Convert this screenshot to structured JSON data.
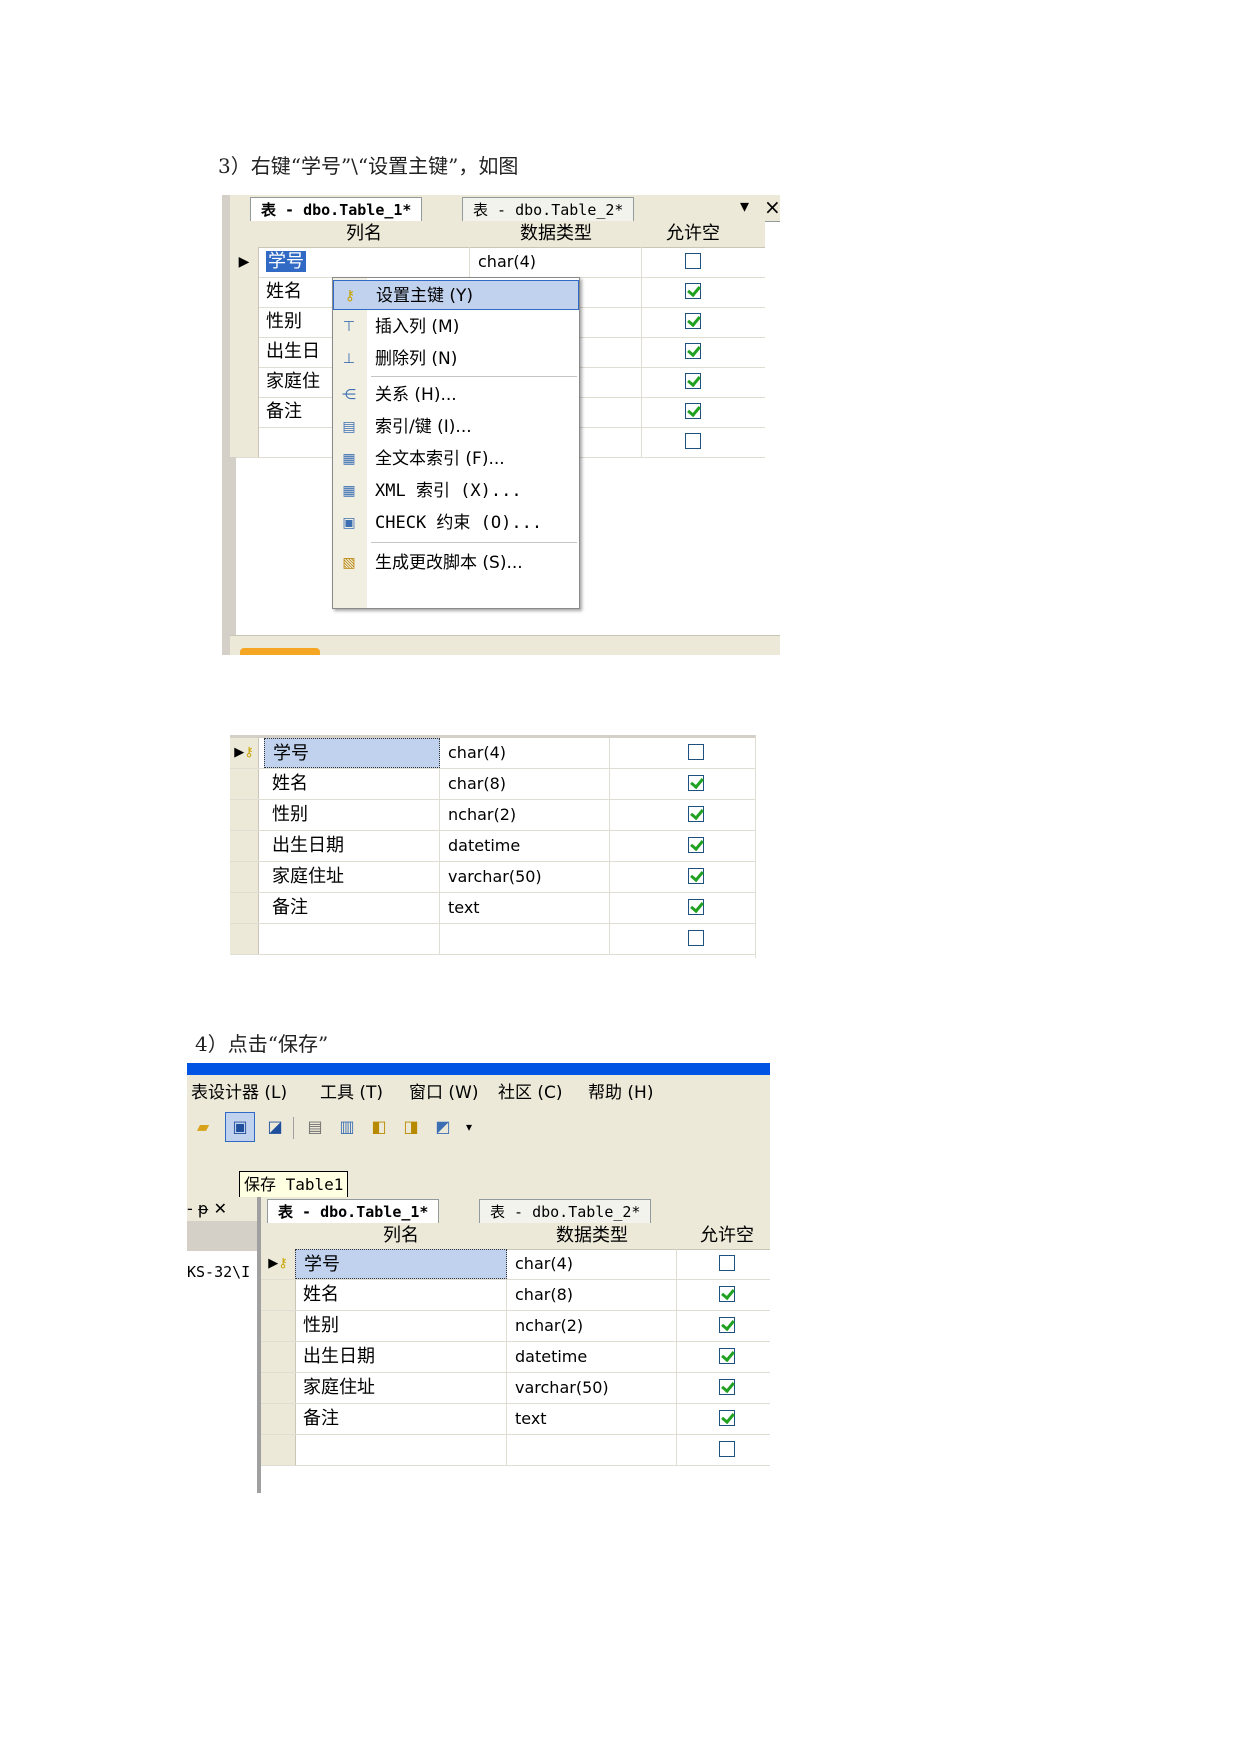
{
  "step3": {
    "caption": "3）右键“学号”\\“设置主键”，如图",
    "tab1": "表 - dbo.Table_1*",
    "tab2": "表 - dbo.Table_2*",
    "pin": "▾",
    "close": "×",
    "headers": {
      "name": "列名",
      "type": "数据类型",
      "nullable": "允许空"
    },
    "rows": [
      {
        "name": "学号",
        "type": "char(4)",
        "nullable": false
      },
      {
        "name": "姓名",
        "type": "",
        "nullable": true
      },
      {
        "name": "性别",
        "type": "",
        "nullable": true
      },
      {
        "name": "出生日",
        "type": "",
        "nullable": true
      },
      {
        "name": "家庭住",
        "type": "",
        "nullable": true
      },
      {
        "name": "备注",
        "type": "",
        "nullable": true
      },
      {
        "name": "",
        "type": "",
        "nullable": false
      }
    ],
    "context_menu": [
      {
        "label": "设置主键 (Y)",
        "icon": "key-icon"
      },
      {
        "label": "插入列 (M)",
        "icon": "insert-column-icon"
      },
      {
        "label": "删除列 (N)",
        "icon": "delete-column-icon"
      },
      {
        "label": "关系 (H)...",
        "icon": "relationship-icon"
      },
      {
        "label": "索引/键 (I)...",
        "icon": "index-icon"
      },
      {
        "label": "全文本索引 (F)...",
        "icon": "fulltext-index-icon"
      },
      {
        "label": "XML 索引 (X)...",
        "icon": "xml-index-icon"
      },
      {
        "label": "CHECK 约束 (O)...",
        "icon": "check-constraint-icon"
      },
      {
        "label": "生成更改脚本 (S)...",
        "icon": "script-icon"
      }
    ]
  },
  "result": {
    "rows": [
      {
        "name": "学号",
        "type": "char(4)",
        "nullable": false,
        "pk": true
      },
      {
        "name": "姓名",
        "type": "char(8)",
        "nullable": true
      },
      {
        "name": "性别",
        "type": "nchar(2)",
        "nullable": true
      },
      {
        "name": "出生日期",
        "type": "datetime",
        "nullable": true
      },
      {
        "name": "家庭住址",
        "type": "varchar(50)",
        "nullable": true
      },
      {
        "name": "备注",
        "type": "text",
        "nullable": true
      },
      {
        "name": "",
        "type": "",
        "nullable": false
      }
    ]
  },
  "step4": {
    "caption": "4）点击“保存”",
    "menubar": [
      "表设计器 (L)",
      "工具 (T)",
      "窗口 (W)",
      "社区 (C)",
      "帮助 (H)"
    ],
    "tooltip": "保存 Table1",
    "panel_controls": "- ᵽ ✕",
    "server_text": "KS-32\\I",
    "tab1": "表 - dbo.Table_1*",
    "tab2": "表 - dbo.Table_2*",
    "headers": {
      "name": "列名",
      "type": "数据类型",
      "nullable": "允许空"
    },
    "rows": [
      {
        "name": "学号",
        "type": "char(4)",
        "nullable": false,
        "pk": true
      },
      {
        "name": "姓名",
        "type": "char(8)",
        "nullable": true
      },
      {
        "name": "性别",
        "type": "nchar(2)",
        "nullable": true
      },
      {
        "name": "出生日期",
        "type": "datetime",
        "nullable": true
      },
      {
        "name": "家庭住址",
        "type": "varchar(50)",
        "nullable": true
      },
      {
        "name": "备注",
        "type": "text",
        "nullable": true
      },
      {
        "name": "",
        "type": "",
        "nullable": false
      }
    ]
  },
  "colors": {
    "selection": "#c1d2ee",
    "titlebar": "#0054e3",
    "checkmark": "#21a121"
  }
}
